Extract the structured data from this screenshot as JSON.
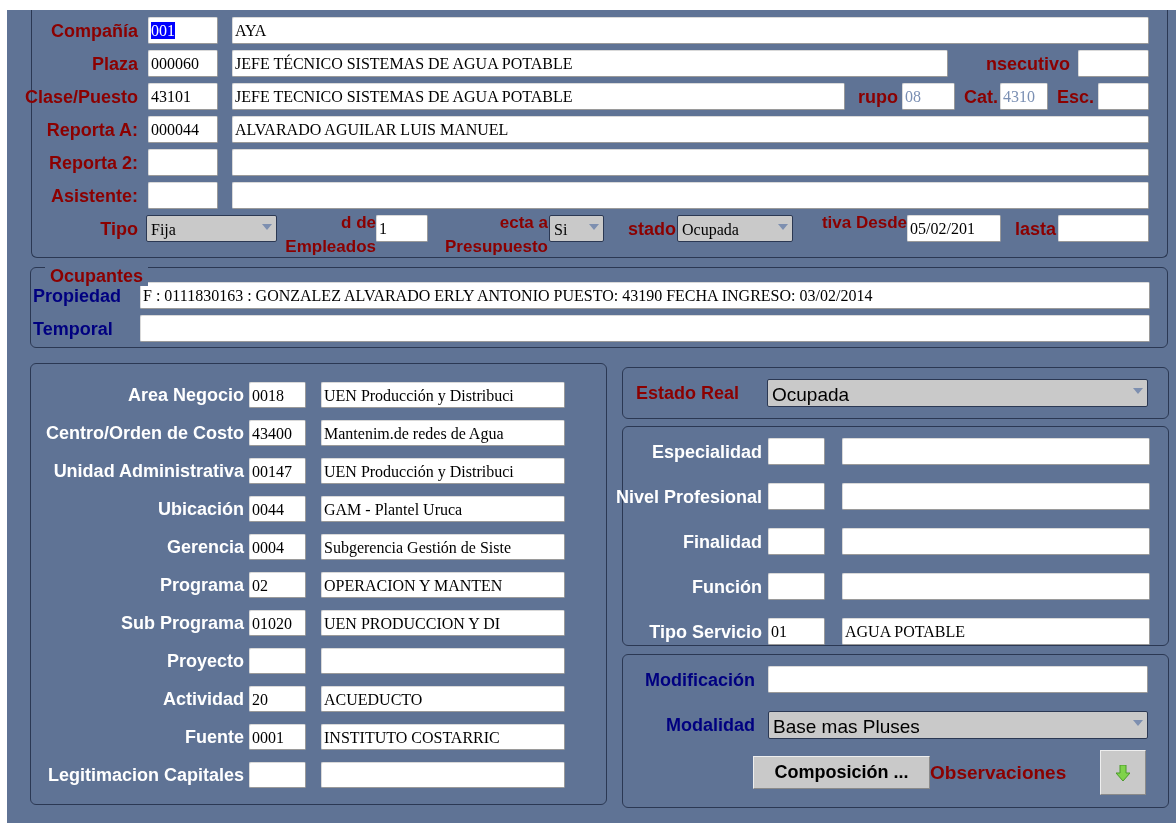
{
  "main": {
    "rows": [
      {
        "items": [
          {
            "kind": "label",
            "text": "Compañía"
          },
          {
            "kind": "field",
            "value": "001",
            "highlighted": true,
            "disabled": false
          },
          {
            "kind": "field",
            "value": "AYA",
            "highlighted": false,
            "disabled": false
          }
        ]
      },
      {
        "items": [
          {
            "kind": "label",
            "text": "Plaza"
          },
          {
            "kind": "field",
            "value": "000060",
            "highlighted": false,
            "disabled": false
          },
          {
            "kind": "field",
            "value": "JEFE TÉCNICO SISTEMAS DE AGUA POTABLE",
            "highlighted": false,
            "disabled": false
          },
          {
            "kind": "label",
            "text": "nsecutivo"
          },
          {
            "kind": "field",
            "value": ""
          }
        ]
      },
      {
        "items": [
          {
            "kind": "label",
            "text": "Clase/Puesto"
          },
          {
            "kind": "field",
            "value": "43101",
            "highlighted": false,
            "disabled": false
          },
          {
            "kind": "field",
            "value": "JEFE TECNICO SISTEMAS DE AGUA POTABLE",
            "highlighted": false,
            "disabled": false
          },
          {
            "kind": "label",
            "text": "rupo"
          },
          {
            "kind": "field",
            "value": "08",
            "highlighted": false,
            "disabled": true
          },
          {
            "kind": "label",
            "text": "Cat."
          },
          {
            "kind": "field",
            "value": "4310",
            "highlighted": false,
            "disabled": true
          },
          {
            "kind": "label",
            "text": "Esc."
          },
          {
            "kind": "field",
            "value": ""
          }
        ]
      },
      {
        "items": [
          {
            "kind": "label",
            "text": "Reporta A:"
          },
          {
            "kind": "field",
            "value": "000044",
            "highlighted": false,
            "disabled": false
          },
          {
            "kind": "field",
            "value": "ALVARADO AGUILAR LUIS MANUEL",
            "highlighted": false,
            "disabled": false
          }
        ]
      },
      {
        "items": [
          {
            "kind": "label",
            "text": "Reporta 2:"
          },
          {
            "kind": "field",
            "value": ""
          },
          {
            "kind": "field",
            "value": ""
          }
        ]
      },
      {
        "items": [
          {
            "kind": "label",
            "text": "Asistente:"
          },
          {
            "kind": "field",
            "value": ""
          },
          {
            "kind": "field",
            "value": ""
          }
        ]
      },
      {
        "items": [
          {
            "kind": "label",
            "text": "Tipo"
          },
          {
            "kind": "select",
            "value": "Fija"
          },
          {
            "kind": "label",
            "text": "d de Empleados"
          },
          {
            "kind": "field",
            "value": "1",
            "highlighted": false,
            "disabled": false
          },
          {
            "kind": "label",
            "text": "ecta a Presupuesto"
          },
          {
            "kind": "select",
            "value": "Si"
          },
          {
            "kind": "label",
            "text": "stado"
          },
          {
            "kind": "select",
            "value": "Ocupada"
          },
          {
            "kind": "label",
            "text": "tiva Desde"
          },
          {
            "kind": "field",
            "value": "05/02/201",
            "highlighted": false,
            "disabled": false
          },
          {
            "kind": "label",
            "text": "lasta"
          },
          {
            "kind": "field",
            "value": ""
          }
        ]
      }
    ]
  },
  "ocupantes": {
    "title": "Ocupantes",
    "rows": [
      {
        "items": [
          {
            "kind": "label",
            "text": "Propiedad"
          },
          {
            "kind": "field",
            "value": "F : 0111830163 : GONZALEZ ALVARADO ERLY ANTONIO PUESTO: 43190 FECHA INGRESO: 03/02/2014"
          }
        ]
      },
      {
        "items": [
          {
            "kind": "label",
            "text": "Temporal"
          },
          {
            "kind": "field",
            "value": ""
          }
        ]
      }
    ]
  },
  "costos": {
    "rows": [
      {
        "items": [
          {
            "kind": "label",
            "text": "Area Negocio"
          },
          {
            "kind": "field",
            "value": "0018"
          },
          {
            "kind": "field",
            "value": "UEN Producción y Distribuci"
          }
        ]
      },
      {
        "items": [
          {
            "kind": "label",
            "text": "Centro/Orden de Costo"
          },
          {
            "kind": "field",
            "value": "43400"
          },
          {
            "kind": "field",
            "value": "Mantenim.de redes de Agua"
          }
        ]
      },
      {
        "items": [
          {
            "kind": "label",
            "text": "Unidad Administrativa"
          },
          {
            "kind": "field",
            "value": "00147"
          },
          {
            "kind": "field",
            "value": "UEN Producción y Distribuci"
          }
        ]
      },
      {
        "items": [
          {
            "kind": "label",
            "text": "Ubicación"
          },
          {
            "kind": "field",
            "value": "0044"
          },
          {
            "kind": "field",
            "value": "GAM - Plantel Uruca"
          }
        ]
      },
      {
        "items": [
          {
            "kind": "label",
            "text": "Gerencia"
          },
          {
            "kind": "field",
            "value": "0004"
          },
          {
            "kind": "field",
            "value": "Subgerencia Gestión de Siste"
          }
        ]
      },
      {
        "items": [
          {
            "kind": "label",
            "text": "Programa"
          },
          {
            "kind": "field",
            "value": "02"
          },
          {
            "kind": "field",
            "value": "OPERACION Y MANTEN"
          }
        ]
      },
      {
        "items": [
          {
            "kind": "label",
            "text": "Sub Programa"
          },
          {
            "kind": "field",
            "value": "01020"
          },
          {
            "kind": "field",
            "value": "UEN PRODUCCION Y DI"
          }
        ]
      },
      {
        "items": [
          {
            "kind": "label",
            "text": "Proyecto"
          },
          {
            "kind": "field",
            "value": ""
          },
          {
            "kind": "field",
            "value": ""
          }
        ]
      },
      {
        "items": [
          {
            "kind": "label",
            "text": "Actividad"
          },
          {
            "kind": "field",
            "value": "20"
          },
          {
            "kind": "field",
            "value": "ACUEDUCTO"
          }
        ]
      },
      {
        "items": [
          {
            "kind": "label",
            "text": "Fuente"
          },
          {
            "kind": "field",
            "value": "0001"
          },
          {
            "kind": "field",
            "value": "INSTITUTO COSTARRIC"
          }
        ]
      },
      {
        "items": [
          {
            "kind": "label",
            "text": "Legitimacion Capitales"
          },
          {
            "kind": "field",
            "value": ""
          },
          {
            "kind": "field",
            "value": ""
          }
        ]
      }
    ]
  },
  "estado_real": {
    "rows": [
      {
        "items": [
          {
            "kind": "label",
            "text": "Estado Real"
          },
          {
            "kind": "select",
            "value": "Ocupada"
          }
        ]
      }
    ]
  },
  "clasificacion": {
    "rows": [
      {
        "items": [
          {
            "kind": "label",
            "text": "Especialidad"
          },
          {
            "kind": "field",
            "value": ""
          },
          {
            "kind": "field",
            "value": ""
          }
        ]
      },
      {
        "items": [
          {
            "kind": "label",
            "text": "Nivel Profesional"
          },
          {
            "kind": "field",
            "value": ""
          },
          {
            "kind": "field",
            "value": ""
          }
        ]
      },
      {
        "items": [
          {
            "kind": "label",
            "text": "Finalidad"
          },
          {
            "kind": "field",
            "value": ""
          },
          {
            "kind": "field",
            "value": ""
          }
        ]
      },
      {
        "items": [
          {
            "kind": "label",
            "text": "Función"
          },
          {
            "kind": "field",
            "value": ""
          },
          {
            "kind": "field",
            "value": ""
          }
        ]
      },
      {
        "items": [
          {
            "kind": "label",
            "text": "Tipo Servicio"
          },
          {
            "kind": "field",
            "value": "01"
          },
          {
            "kind": "field",
            "value": "AGUA POTABLE"
          }
        ]
      }
    ]
  },
  "modificacion": {
    "rows": [
      {
        "items": [
          {
            "kind": "label",
            "text": "Modificación"
          },
          {
            "kind": "field",
            "value": ""
          }
        ]
      },
      {
        "items": [
          {
            "kind": "label",
            "text": "Modalidad"
          },
          {
            "kind": "select",
            "value": "Base mas Pluses"
          }
        ]
      },
      {
        "items": [
          {
            "kind": "button",
            "text": "Composición ..."
          },
          {
            "kind": "note",
            "text": "Observaciones"
          },
          {
            "kind": "icon_button"
          }
        ]
      }
    ]
  }
}
